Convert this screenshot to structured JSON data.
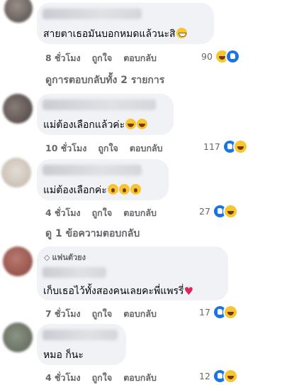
{
  "comments": [
    {
      "text": "สายตาเธอมันบอกหมดแล้วนะสิ",
      "time": "8 ชั่วโมง",
      "like": "ถูกใจ",
      "reply": "ตอบกลับ",
      "count": "90"
    },
    {
      "text": "แม่ต้องเลือกแล้วค่ะ",
      "time": "10 ชั่วโมง",
      "like": "ถูกใจ",
      "reply": "ตอบกลับ",
      "count": "117"
    },
    {
      "text": "แม่ต้องเลือกค่ะ",
      "time": "4 ชั่วโมง",
      "like": "ถูกใจ",
      "reply": "ตอบกลับ",
      "count": "27"
    },
    {
      "badge": "แฟนตัวยง",
      "text": "เก็บเธอไว้ทั้งสองคนเลยคะพี่แพรรี่",
      "time": "7 ชั่วโมง",
      "like": "ถูกใจ",
      "reply": "ตอบกลับ",
      "count": "17"
    },
    {
      "text": "หมอ ก็นะ",
      "time": "4 ชั่วโมง",
      "like": "ถูกใจ",
      "reply": "ตอบกลับ",
      "count": "12"
    }
  ],
  "view_replies_1": "ดูการตอบกลับทั้ง 2 รายการ",
  "view_replies_2": "ดู 1 ข้อความตอบกลับ",
  "icons": {
    "reaction_haha": "haha-reaction-icon",
    "reaction_like": "like-reaction-icon",
    "badge": "diamond-icon"
  },
  "colors": {
    "bubble": "#f0f2f5",
    "meta": "#65676b",
    "like_blue": "#1b74e4",
    "haha_yellow": "#f7c531",
    "heart": "#e0245e"
  }
}
